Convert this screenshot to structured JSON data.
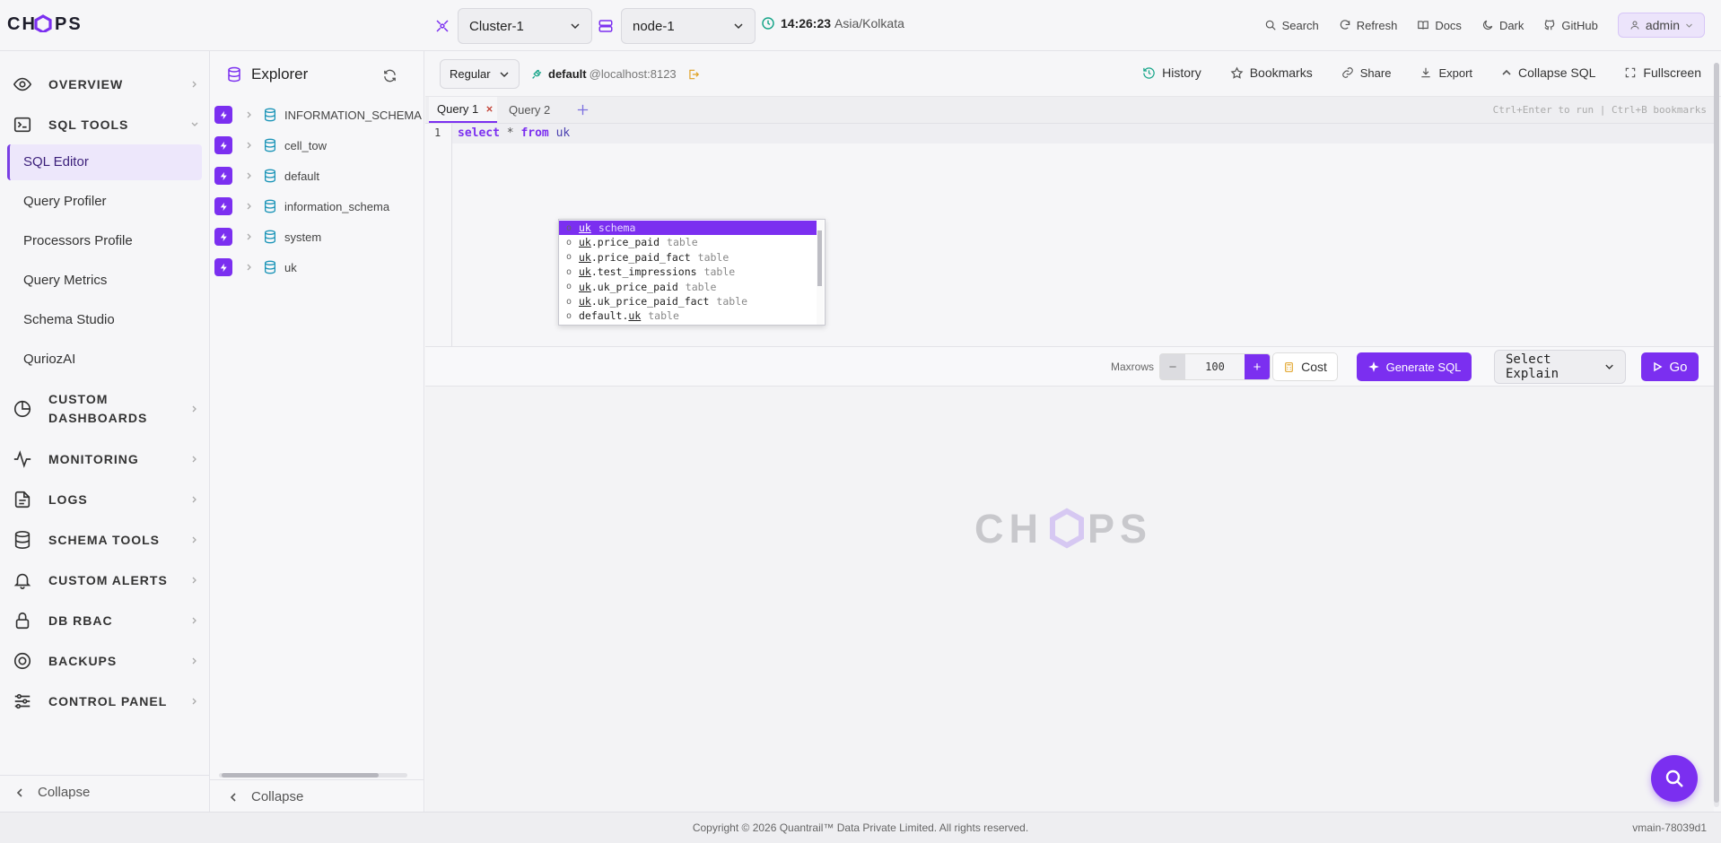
{
  "app": {
    "logo_text": "CHOPS",
    "colors": {
      "accent": "#7b2ff0",
      "accent_light": "#ede7fb",
      "teal": "#17a589"
    }
  },
  "topbar": {
    "cluster": "Cluster-1",
    "node": "node-1",
    "time": "14:26:23",
    "timezone": "Asia/Kolkata",
    "actions": [
      {
        "label": "Search",
        "icon": "search-icon"
      },
      {
        "label": "Refresh",
        "icon": "refresh-icon"
      },
      {
        "label": "Docs",
        "icon": "book-icon"
      },
      {
        "label": "Dark",
        "icon": "moon-icon"
      },
      {
        "label": "GitHub",
        "icon": "github-icon"
      }
    ],
    "user": "admin"
  },
  "sidebar": {
    "sections": [
      {
        "label": "OVERVIEW",
        "icon": "eye-icon"
      },
      {
        "label": "SQL TOOLS",
        "icon": "terminal-icon"
      },
      {
        "label": "CUSTOM",
        "label2": "DASHBOARDS",
        "icon": "pie-chart-icon"
      },
      {
        "label": "MONITORING",
        "icon": "activity-icon"
      },
      {
        "label": "LOGS",
        "icon": "file-icon"
      },
      {
        "label": "SCHEMA TOOLS",
        "icon": "database-icon"
      },
      {
        "label": "CUSTOM ALERTS",
        "icon": "bell-icon"
      },
      {
        "label": "DB RBAC",
        "icon": "lock-icon"
      },
      {
        "label": "BACKUPS",
        "icon": "life-buoy-icon"
      },
      {
        "label": "CONTROL PANEL",
        "icon": "sliders-icon"
      }
    ],
    "sql_tools_items": [
      "SQL Editor",
      "Query Profiler",
      "Processors Profile",
      "Query Metrics",
      "Schema Studio",
      "QuriozAI"
    ],
    "collapse_label": "Collapse"
  },
  "explorer": {
    "title": "Explorer",
    "databases": [
      "INFORMATION_SCHEMA",
      "cell_tow",
      "default",
      "information_schema",
      "system",
      "uk"
    ],
    "collapse_label": "Collapse"
  },
  "editor": {
    "mode": "Regular",
    "connection_db": "default",
    "connection_host": "@localhost:8123",
    "toolbar_actions": [
      {
        "label": "History",
        "icon": "history-icon"
      },
      {
        "label": "Bookmarks",
        "icon": "star-icon"
      },
      {
        "label": "Share",
        "icon": "link-icon"
      },
      {
        "label": "Export",
        "icon": "download-icon"
      },
      {
        "label": "Collapse SQL",
        "icon": "chevron-up-icon"
      },
      {
        "label": "Fullscreen",
        "icon": "expand-icon"
      }
    ],
    "tabs": [
      "Query 1",
      "Query 2"
    ],
    "shortcut_hint": "Ctrl+Enter to run | Ctrl+B bookmarks",
    "line_number": "1",
    "code": {
      "kw1": "select",
      "star": "*",
      "kw2": "from",
      "ident": "uk"
    },
    "autocomplete": [
      {
        "prefix": "uk",
        "rest": "",
        "type": "schema"
      },
      {
        "prefix": "uk",
        "rest": ".price_paid",
        "type": "table"
      },
      {
        "prefix": "uk",
        "rest": ".price_paid_fact",
        "type": "table"
      },
      {
        "prefix": "uk",
        "rest": ".test_impressions",
        "type": "table"
      },
      {
        "prefix": "uk",
        "rest": ".uk_price_paid",
        "type": "table"
      },
      {
        "prefix": "uk",
        "rest": ".uk_price_paid_fact",
        "type": "table"
      },
      {
        "prefix": "default.",
        "prefix_plain": true,
        "underline": "uk",
        "rest": "",
        "type": "table"
      }
    ],
    "maxrows_label": "Maxrows",
    "maxrows_value": "100",
    "cost_label": "Cost",
    "generate_label": "Generate SQL",
    "explain_placeholder": "Select Explain",
    "go_label": "Go"
  },
  "footer": {
    "copyright": "Copyright © 2026 Quantrail™ Data Private Limited. All rights reserved.",
    "version": "vmain-78039d1"
  }
}
